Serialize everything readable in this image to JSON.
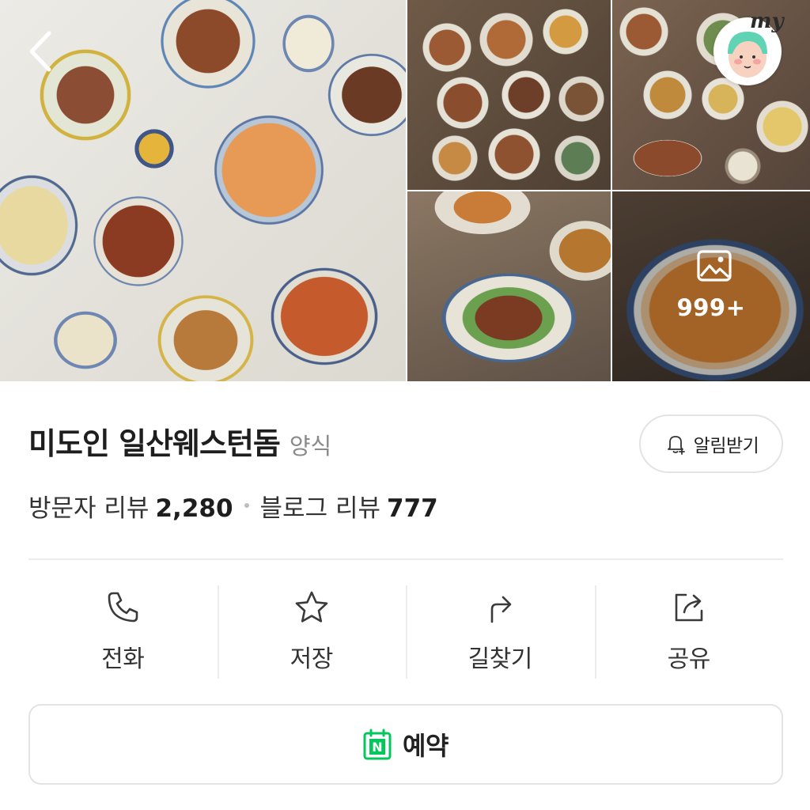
{
  "gallery": {
    "more_count": "999+"
  },
  "my_badge": "my",
  "place": {
    "name": "미도인 일산웨스턴돔",
    "category": "양식"
  },
  "alert_button": {
    "label": "알림받기"
  },
  "reviews": {
    "visitor_label": "방문자 리뷰",
    "visitor_count": "2,280",
    "blog_label": "블로그 리뷰",
    "blog_count": "777"
  },
  "actions": [
    {
      "label": "전화",
      "icon": "phone-icon"
    },
    {
      "label": "저장",
      "icon": "star-icon"
    },
    {
      "label": "길찾기",
      "icon": "directions-icon"
    },
    {
      "label": "공유",
      "icon": "share-icon"
    }
  ],
  "reserve": {
    "label": "예약",
    "icon": "naver-booking-icon",
    "icon_letter": "N"
  },
  "colors": {
    "brand_green": "#03c75a",
    "text_primary": "#1e1e1e",
    "text_secondary": "#8a8a8a",
    "border": "#e3e3e3"
  }
}
